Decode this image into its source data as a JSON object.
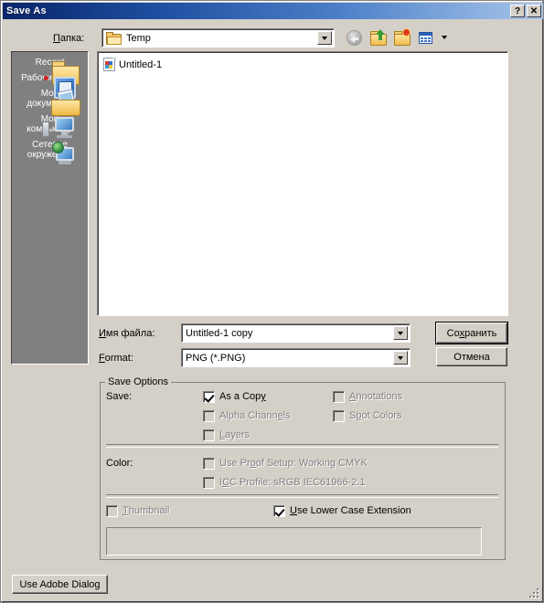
{
  "window": {
    "title": "Save As",
    "help_button": "?",
    "close_button": "✕"
  },
  "lookin": {
    "label": "Папка:",
    "label_prefix": "П",
    "label_rest": "апка:",
    "value": "Temp",
    "folder_icon": "folder-icon",
    "dropdown_icon": "chevron-down-icon"
  },
  "toolbar": {
    "back": "back-icon",
    "up_one_level": "up-one-level-icon",
    "new_folder": "new-folder-icon",
    "views": "views-icon",
    "views_arrow": "chevron-down-icon"
  },
  "places": {
    "items": [
      {
        "label": "Recent",
        "icon": "recent-folder-icon"
      },
      {
        "label": "Рабочий стол",
        "icon": "desktop-icon"
      },
      {
        "label": "Мои\nдокументы",
        "icon": "my-documents-icon"
      },
      {
        "label": "Мой\nкомпьютер",
        "icon": "my-computer-icon"
      },
      {
        "label": "Сетевое\nокружение",
        "icon": "network-places-icon"
      }
    ]
  },
  "filelist": {
    "files": [
      {
        "name": "Untitled-1",
        "icon": "png-file-icon"
      }
    ]
  },
  "filename": {
    "label_prefix": "И",
    "label_rest": "мя файла:",
    "label": "Имя файла:",
    "value": "Untitled-1 copy"
  },
  "format": {
    "label_prefix": "F",
    "label_rest": "ormat:",
    "label": "Format:",
    "value": "PNG (*.PNG)"
  },
  "buttons": {
    "save_prefix": "Со",
    "save_accel": "х",
    "save_suffix": "ранить",
    "save": "Сохранить",
    "cancel": "Отмена",
    "use_adobe_dialog": "Use Adobe Dialog"
  },
  "save_options": {
    "group_title": "Save Options",
    "save_label": "Save:",
    "color_label": "Color:",
    "checkboxes": [
      {
        "id": "as-a-copy",
        "pre": "As a Cop",
        "accel": "y",
        "post": "",
        "label": "As a Copy",
        "checked": true,
        "disabled": false
      },
      {
        "id": "alpha-channels",
        "pre": "Alpha Chann",
        "accel": "e",
        "post": "ls",
        "label": "Alpha Channels",
        "checked": false,
        "disabled": true
      },
      {
        "id": "layers",
        "pre": "",
        "accel": "L",
        "post": "ayers",
        "label": "Layers",
        "checked": false,
        "disabled": true
      },
      {
        "id": "annotations",
        "pre": "",
        "accel": "A",
        "post": "nnotations",
        "label": "Annotations",
        "checked": false,
        "disabled": true
      },
      {
        "id": "spot-colors",
        "pre": "S",
        "accel": "p",
        "post": "ot Colors",
        "label": "Spot Colors",
        "checked": false,
        "disabled": true
      },
      {
        "id": "use-proof-setup",
        "pre": "Use Pr",
        "accel": "o",
        "post": "of Setup:  Working CMYK",
        "label": "Use Proof Setup:  Working CMYK",
        "checked": false,
        "disabled": true
      },
      {
        "id": "icc-profile",
        "pre": "I",
        "accel": "C",
        "post": "C Profile:  sRGB IEC61966-2.1",
        "label": "ICC Profile:  sRGB IEC61966-2.1",
        "checked": false,
        "disabled": true
      },
      {
        "id": "thumbnail",
        "pre": "",
        "accel": "T",
        "post": "humbnail",
        "label": "Thumbnail",
        "checked": false,
        "disabled": true
      },
      {
        "id": "use-lower-case-extension",
        "pre": "",
        "accel": "U",
        "post": "se Lower Case Extension",
        "label": "Use Lower Case Extension",
        "checked": true,
        "disabled": false
      }
    ]
  },
  "colors": {
    "title_start": "#0a246a",
    "title_end": "#a8c4ea",
    "dialog_face": "#d4d0c8",
    "places_bar": "#808080",
    "disabled_text": "#808080"
  }
}
